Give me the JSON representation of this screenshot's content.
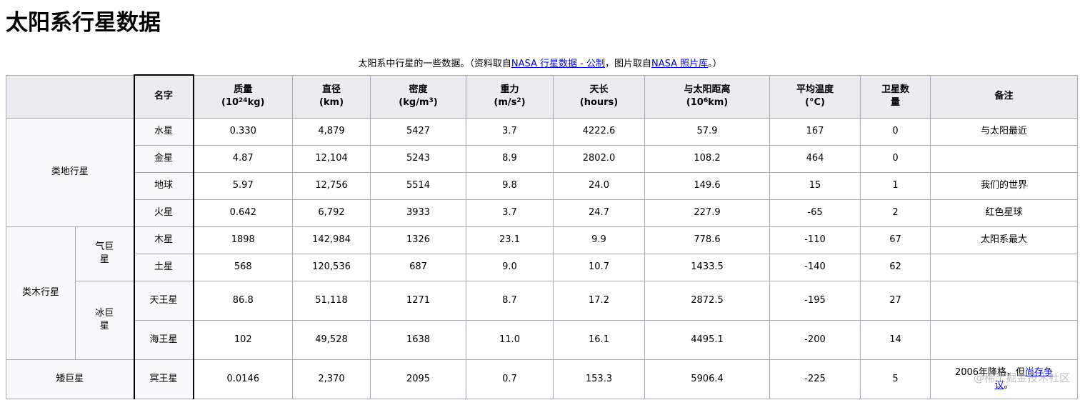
{
  "title": "太阳系行星数据",
  "caption": {
    "prefix": "太阳系中行星的一些数据。（资料取自",
    "link1": "NASA 行星数据 - 公制",
    "middle": "，图片取自",
    "link2": "NASA 照片库",
    "suffix": "。）"
  },
  "headers": {
    "name": "名字",
    "mass": {
      "line1": "质量",
      "pre": "(10",
      "sup": "24",
      "post": "kg)"
    },
    "diameter": {
      "line1": "直径",
      "line2": "(km)"
    },
    "density": {
      "line1": "密度",
      "pre": "(kg/m",
      "sup": "3",
      "post": ")"
    },
    "gravity": {
      "line1": "重力",
      "pre": "(m/s",
      "sup": "2",
      "post": ")"
    },
    "day": {
      "line1": "天长",
      "line2": "(hours)"
    },
    "distance": {
      "line1": "与太阳距离",
      "pre": "(10",
      "sup": "6",
      "post": "km)"
    },
    "temp": {
      "line1": "平均温度",
      "line2": "(°C)"
    },
    "moons": "卫星数量",
    "notes": "备注"
  },
  "groups": {
    "terrestrial": "类地行星",
    "jovian": "类木行星",
    "gas_giant": "气巨星",
    "ice_giant": "冰巨星",
    "dwarf": "矮巨星"
  },
  "rows": [
    {
      "name": "水星",
      "mass": "0.330",
      "diameter": "4,879",
      "density": "5427",
      "gravity": "3.7",
      "day": "4222.6",
      "distance": "57.9",
      "temp": "167",
      "moons": "0",
      "notes": "与太阳最近"
    },
    {
      "name": "金星",
      "mass": "4.87",
      "diameter": "12,104",
      "density": "5243",
      "gravity": "8.9",
      "day": "2802.0",
      "distance": "108.2",
      "temp": "464",
      "moons": "0",
      "notes": ""
    },
    {
      "name": "地球",
      "mass": "5.97",
      "diameter": "12,756",
      "density": "5514",
      "gravity": "9.8",
      "day": "24.0",
      "distance": "149.6",
      "temp": "15",
      "moons": "1",
      "notes": "我们的世界"
    },
    {
      "name": "火星",
      "mass": "0.642",
      "diameter": "6,792",
      "density": "3933",
      "gravity": "3.7",
      "day": "24.7",
      "distance": "227.9",
      "temp": "-65",
      "moons": "2",
      "notes": "红色星球"
    },
    {
      "name": "木星",
      "mass": "1898",
      "diameter": "142,984",
      "density": "1326",
      "gravity": "23.1",
      "day": "9.9",
      "distance": "778.6",
      "temp": "-110",
      "moons": "67",
      "notes": "太阳系最大"
    },
    {
      "name": "土星",
      "mass": "568",
      "diameter": "120,536",
      "density": "687",
      "gravity": "9.0",
      "day": "10.7",
      "distance": "1433.5",
      "temp": "-140",
      "moons": "62",
      "notes": ""
    },
    {
      "name": "天王星",
      "mass": "86.8",
      "diameter": "51,118",
      "density": "1271",
      "gravity": "8.7",
      "day": "17.2",
      "distance": "2872.5",
      "temp": "-195",
      "moons": "27",
      "notes": ""
    },
    {
      "name": "海王星",
      "mass": "102",
      "diameter": "49,528",
      "density": "1638",
      "gravity": "11.0",
      "day": "16.1",
      "distance": "4495.1",
      "temp": "-200",
      "moons": "14",
      "notes": ""
    },
    {
      "name": "冥王星",
      "mass": "0.0146",
      "diameter": "2,370",
      "density": "2095",
      "gravity": "0.7",
      "day": "153.3",
      "distance": "5906.4",
      "temp": "-225",
      "moons": "5",
      "notes": "2006年降格，但",
      "notes_link": "尚存争议",
      "notes_suffix": "。"
    }
  ],
  "watermark": "@稀土掘金技术社区"
}
